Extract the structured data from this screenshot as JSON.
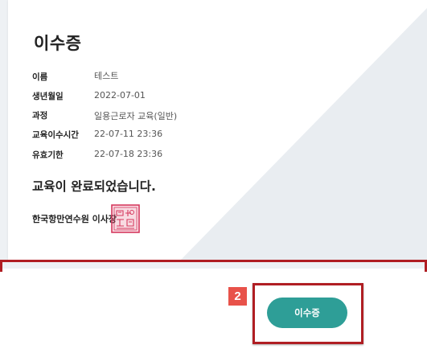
{
  "certificate": {
    "title": "이수증",
    "fields": [
      {
        "label": "이름",
        "value": "테스트"
      },
      {
        "label": "생년월일",
        "value": "2022-07-01"
      },
      {
        "label": "과정",
        "value": "일용근로자 교육(일반)"
      },
      {
        "label": "교육이수시간",
        "value": "22-07-11 23:36"
      },
      {
        "label": "유효기한",
        "value": "22-07-18 23:36"
      }
    ],
    "completion_message": "교육이 완료되었습니다.",
    "issuer": "한국항만연수원 이사장",
    "seal_icon": "official-seal-stamp"
  },
  "annotation": {
    "step_number": "2",
    "highlight_color": "#b01e23",
    "badge_color": "#e8524a"
  },
  "actions": {
    "certificate_button_label": "이수증",
    "button_color": "#2e9e97"
  }
}
